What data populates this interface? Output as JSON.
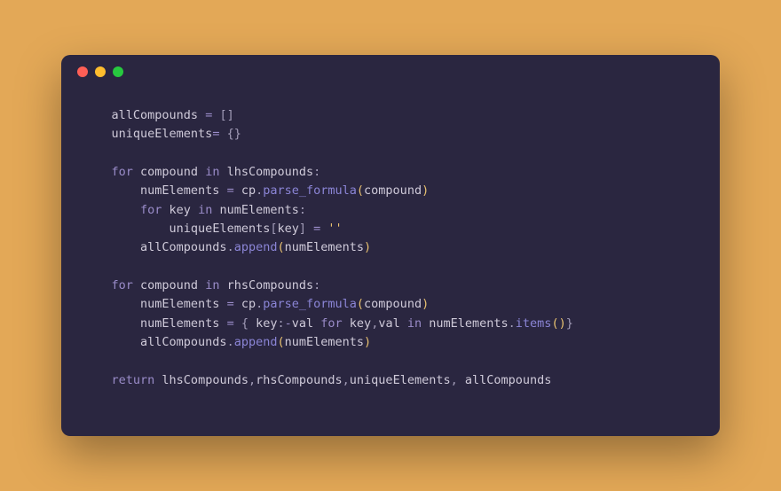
{
  "code": {
    "line1_var": "allCompounds",
    "line1_op": " = ",
    "line1_brackets": "[]",
    "line2_var": "uniqueElements",
    "line2_op": "= ",
    "line2_braces": "{}",
    "line4_for": "for",
    "line4_compound": " compound ",
    "line4_in": "in",
    "line4_lhs": " lhsCompounds",
    "line4_colon": ":",
    "line5_var": "numElements",
    "line5_op": " = ",
    "line5_cp": "cp",
    "line5_dot": ".",
    "line5_method": "parse_formula",
    "line5_open": "(",
    "line5_arg": "compound",
    "line5_close": ")",
    "line6_for": "for",
    "line6_key": " key ",
    "line6_in": "in",
    "line6_numel": " numElements",
    "line6_colon": ":",
    "line7_var": "uniqueElements",
    "line7_open": "[",
    "line7_key": "key",
    "line7_close": "]",
    "line7_op": " = ",
    "line7_str": "''",
    "line8_var": "allCompounds",
    "line8_dot": ".",
    "line8_method": "append",
    "line8_open": "(",
    "line8_arg": "numElements",
    "line8_close": ")",
    "line10_for": "for",
    "line10_compound": " compound ",
    "line10_in": "in",
    "line10_rhs": " rhsCompounds",
    "line10_colon": ":",
    "line11_var": "numElements",
    "line11_op": " = ",
    "line11_cp": "cp",
    "line11_dot": ".",
    "line11_method": "parse_formula",
    "line11_open": "(",
    "line11_arg": "compound",
    "line11_close": ")",
    "line12_var": "numElements",
    "line12_op": " = ",
    "line12_openbrace": "{ ",
    "line12_key1": "key",
    "line12_colon1": ":",
    "line12_neg": "-",
    "line12_val": "val ",
    "line12_for": "for",
    "line12_keyval": " key",
    "line12_comma": ",",
    "line12_val2": "val ",
    "line12_in": "in",
    "line12_numel": " numElements",
    "line12_dot": ".",
    "line12_items": "items",
    "line12_parens": "()",
    "line12_closebrace": "}",
    "line13_var": "allCompounds",
    "line13_dot": ".",
    "line13_method": "append",
    "line13_open": "(",
    "line13_arg": "numElements",
    "line13_close": ")",
    "line15_return": "return",
    "line15_args": " lhsCompounds",
    "line15_c1": ",",
    "line15_a2": "rhsCompounds",
    "line15_c2": ",",
    "line15_a3": "uniqueElements",
    "line15_c3": ",",
    "line15_a4": " allCompounds"
  }
}
